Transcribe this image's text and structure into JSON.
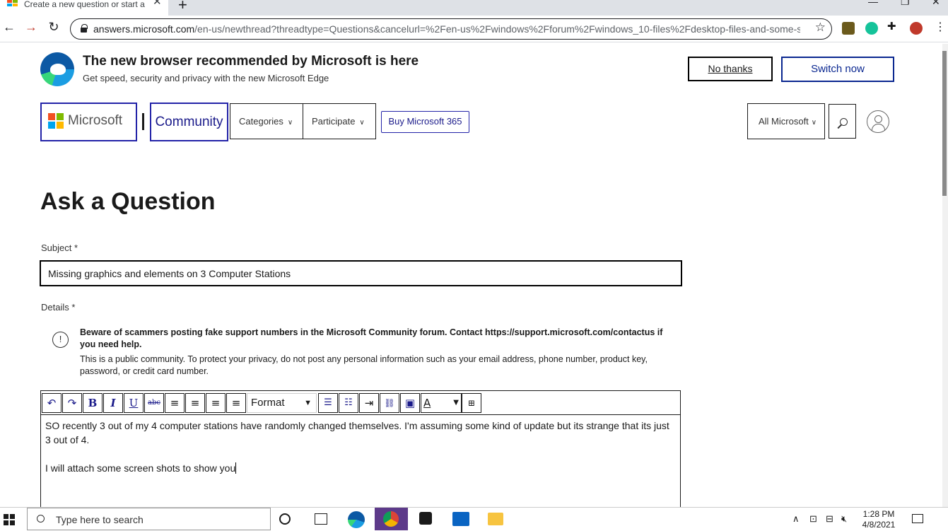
{
  "browser": {
    "tab_title": "Create a new question or start a",
    "tab_close": "✕",
    "new_tab": "+",
    "url_host": "answers.microsoft.com",
    "url_path": "/en-us/newthread?threadtype=Questions&cancelurl=%2Fen-us%2Fwindows%2Fforum%2Fwindows_10-files%2Fdesktop-files-and-some-s..."
  },
  "banner": {
    "title": "The new browser recommended by Microsoft is here",
    "subtitle": "Get speed, security and privacy with the new Microsoft Edge",
    "no_thanks": "No thanks",
    "switch_now": "Switch now"
  },
  "header": {
    "logo_text": "Microsoft",
    "community": "Community",
    "categories": "Categories",
    "participate": "Participate",
    "buy": "Buy Microsoft 365",
    "all_microsoft": "All Microsoft"
  },
  "form": {
    "page_title": "Ask a Question",
    "subject_label": "Subject *",
    "subject_value": "Missing graphics and elements on 3 Computer Stations",
    "details_label": "Details *",
    "warning_bold": "Beware of scammers posting fake support numbers in the Microsoft Community forum. Contact https://support.microsoft.com/contactus if you need help.",
    "warning_text": "This is a public community. To protect your privacy, do not post any personal information such as your email address, phone number, product key, password, or credit card number.",
    "format_label": "Format",
    "body_line1": "SO recently 3 out of my 4 computer stations have randomly changed themselves. I'm assuming some kind of update but its strange that its just 3 out of 4.",
    "body_line2": "I will attach some screen shots to show you"
  },
  "toolbar_icons": {
    "undo": "↶",
    "redo": "↷",
    "bold": "B",
    "italic": "I",
    "underline": "U",
    "strike": "abc",
    "align_left": "≡",
    "align_center": "≡",
    "align_right": "≡",
    "justify": "≡",
    "bullets": "☰",
    "numbered": "☷",
    "indent": "⇥",
    "link": "⛓",
    "image": "▣",
    "font_color": "A"
  },
  "taskbar": {
    "search_placeholder": "Type here to search",
    "time": "1:28 PM",
    "date": "4/8/2021"
  },
  "colors": {
    "accent": "#2323a8",
    "switch_text": "#0a2790"
  }
}
